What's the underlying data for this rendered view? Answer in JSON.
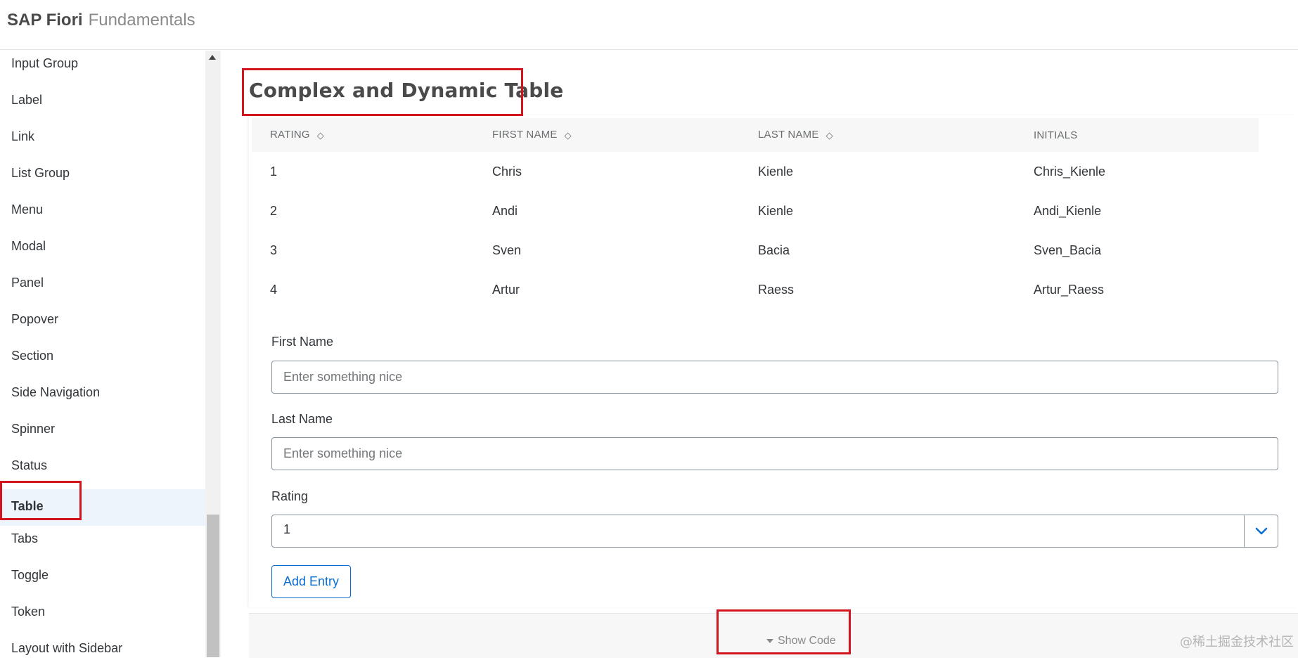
{
  "header": {
    "brand": "SAP Fiori",
    "subtitle": "Fundamentals"
  },
  "sidebar": {
    "items": [
      {
        "label": "Input Group"
      },
      {
        "label": "Label"
      },
      {
        "label": "Link"
      },
      {
        "label": "List Group"
      },
      {
        "label": "Menu"
      },
      {
        "label": "Modal"
      },
      {
        "label": "Panel"
      },
      {
        "label": "Popover"
      },
      {
        "label": "Section"
      },
      {
        "label": "Side Navigation"
      },
      {
        "label": "Spinner"
      },
      {
        "label": "Status"
      },
      {
        "label": "Table"
      },
      {
        "label": "Tabs"
      },
      {
        "label": "Toggle"
      },
      {
        "label": "Token"
      },
      {
        "label": "Layout with Sidebar"
      }
    ],
    "active": "Table"
  },
  "main": {
    "title": "Complex and Dynamic Table",
    "table": {
      "columns": [
        "RATING",
        "FIRST NAME",
        "LAST NAME",
        "INITIALS"
      ],
      "rows": [
        [
          "1",
          "Chris",
          "Kienle",
          "Chris_Kienle"
        ],
        [
          "2",
          "Andi",
          "Kienle",
          "Andi_Kienle"
        ],
        [
          "3",
          "Sven",
          "Bacia",
          "Sven_Bacia"
        ],
        [
          "4",
          "Artur",
          "Raess",
          "Artur_Raess"
        ]
      ]
    },
    "form": {
      "first_name_label": "First Name",
      "first_name_placeholder": "Enter something nice",
      "last_name_label": "Last Name",
      "last_name_placeholder": "Enter something nice",
      "rating_label": "Rating",
      "rating_value": "1",
      "add_button": "Add Entry"
    },
    "show_code": "Show Code"
  },
  "watermark": "@稀土掘金技术社区",
  "colors": {
    "accent": "#0a6ed1",
    "highlight": "#d2141e",
    "active_bg": "#eef4fb"
  }
}
